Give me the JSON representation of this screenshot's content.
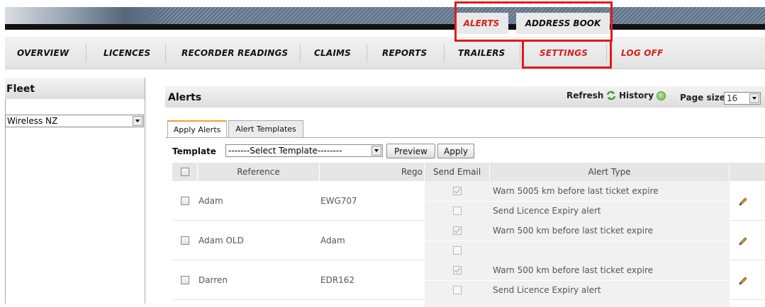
{
  "top_tabs": [
    {
      "label": "ALERTS",
      "state": "active"
    },
    {
      "label": "ADDRESS BOOK",
      "state": "inactive"
    }
  ],
  "nav": {
    "items": [
      {
        "label": "OVERVIEW"
      },
      {
        "label": "LICENCES"
      },
      {
        "label": "RECORDER READINGS"
      },
      {
        "label": "CLAIMS"
      },
      {
        "label": "REPORTS"
      },
      {
        "label": "TRAILERS"
      },
      {
        "label": "SETTINGS"
      },
      {
        "label": "LOG OFF"
      }
    ]
  },
  "sidebar": {
    "title": "Fleet",
    "fleet_value": "Wireless NZ"
  },
  "panel": {
    "title": "Alerts",
    "refresh_label": "Refresh",
    "history_label": "History",
    "page_size_label": "Page size",
    "page_size_value": "16"
  },
  "subtabs": [
    {
      "label": "Apply Alerts",
      "active": true
    },
    {
      "label": "Alert Templates",
      "active": false
    }
  ],
  "template": {
    "label": "Template",
    "select_value": "-------Select Template--------",
    "preview_label": "Preview",
    "apply_label": "Apply"
  },
  "table": {
    "headers": [
      "Reference",
      "Rego",
      "Send Email",
      "Alert Type"
    ],
    "rows": [
      {
        "reference": "Adam",
        "rego": "EWG707",
        "alerts": [
          {
            "send_email": true,
            "type": "Warn 5005 km before last ticket expire"
          },
          {
            "send_email": false,
            "type": "Send Licence Expiry alert"
          }
        ]
      },
      {
        "reference": "Adam OLD",
        "rego": "Adam",
        "alerts": [
          {
            "send_email": true,
            "type": "Warn 500 km before last ticket expire"
          },
          {
            "send_email": false,
            "type": ""
          }
        ]
      },
      {
        "reference": "Darren",
        "rego": "EDR162",
        "alerts": [
          {
            "send_email": true,
            "type": "Warn 500 km before last ticket expire"
          },
          {
            "send_email": false,
            "type": "Send Licence Expiry alert"
          }
        ]
      }
    ]
  },
  "colors": {
    "highlight": "#e01b1b",
    "active_nav": "#d62020"
  }
}
